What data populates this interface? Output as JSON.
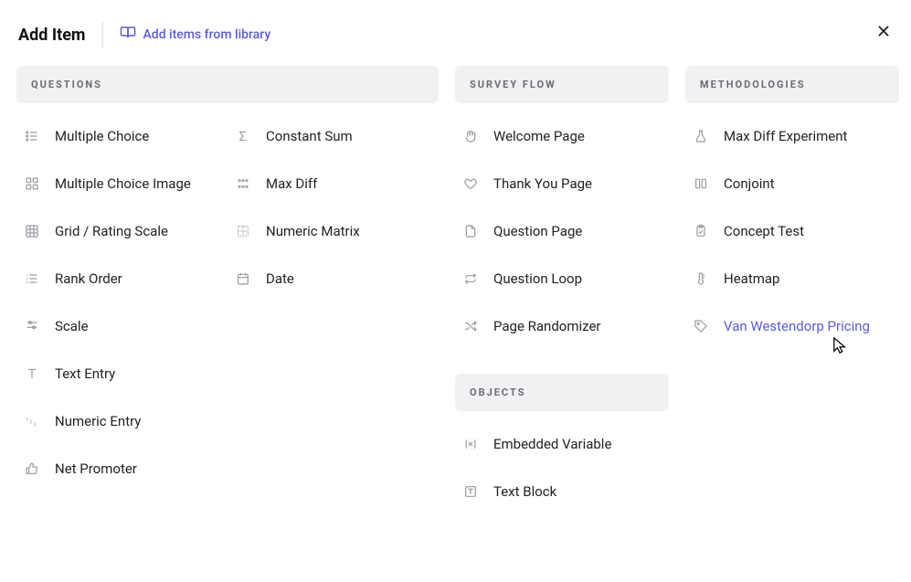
{
  "header": {
    "title": "Add Item",
    "library_link": "Add items from library"
  },
  "sections": {
    "questions_header": "QUESTIONS",
    "flow_header": "SURVEY FLOW",
    "objects_header": "OBJECTS",
    "methodologies_header": "METHODOLOGIES"
  },
  "questions_left": [
    {
      "label": "Multiple Choice"
    },
    {
      "label": "Multiple Choice Image"
    },
    {
      "label": "Grid / Rating Scale"
    },
    {
      "label": "Rank Order"
    },
    {
      "label": "Scale"
    },
    {
      "label": "Text Entry"
    },
    {
      "label": "Numeric Entry"
    },
    {
      "label": "Net Promoter"
    }
  ],
  "questions_right": [
    {
      "label": "Constant Sum"
    },
    {
      "label": "Max Diff"
    },
    {
      "label": "Numeric Matrix"
    },
    {
      "label": "Date"
    }
  ],
  "flow": [
    {
      "label": "Welcome Page"
    },
    {
      "label": "Thank You Page"
    },
    {
      "label": "Question Page"
    },
    {
      "label": "Question Loop"
    },
    {
      "label": "Page Randomizer"
    }
  ],
  "objects": [
    {
      "label": "Embedded Variable"
    },
    {
      "label": "Text Block"
    }
  ],
  "methodologies": [
    {
      "label": "Max Diff Experiment"
    },
    {
      "label": "Conjoint"
    },
    {
      "label": "Concept Test"
    },
    {
      "label": "Heatmap"
    },
    {
      "label": "Van Westendorp Pricing",
      "highlight": true
    }
  ]
}
